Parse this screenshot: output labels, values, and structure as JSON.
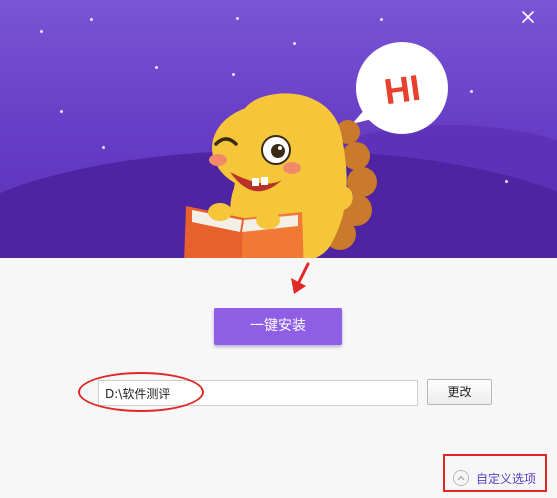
{
  "window": {
    "close_symbol": "×"
  },
  "banner": {
    "speech_bubble_text": "HI",
    "bg_color_top": "#7a55d6",
    "bg_color_bottom": "#5a2eb6"
  },
  "install": {
    "button_label": "一键安装",
    "accent_color": "#8e5ee4"
  },
  "path": {
    "value": "D:\\软件测评",
    "change_label": "更改"
  },
  "options": {
    "custom_label": "自定义选项",
    "icon": "chevron-up-icon"
  },
  "annotations": {
    "highlight_color": "#e02828"
  }
}
